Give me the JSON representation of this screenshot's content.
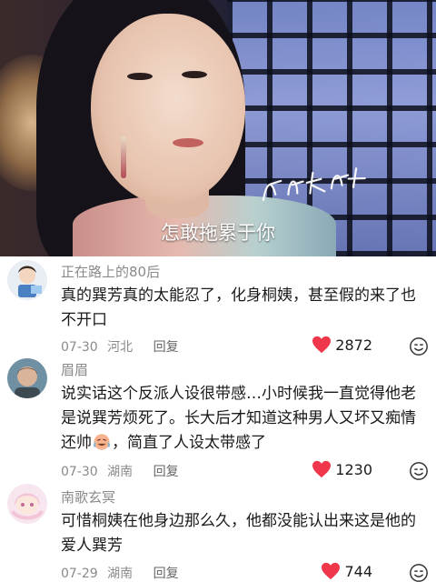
{
  "video": {
    "subtitle": "怎敢拖累于你"
  },
  "comments": [
    {
      "username": "正在路上的80后",
      "text": "真的巽芳真的太能忍了，化身桐姨，甚至假的来了也不开口",
      "date": "07-30",
      "location": "河北",
      "reply_label": "回复",
      "likes": "2872"
    },
    {
      "username": "眉眉",
      "text_before_emoji": "说实话这个反派人设很带感…小时候我一直觉得他老是说巽芳烦死了。长大后才知道这种男人又坏又痴情还帅",
      "emoji": "laughing-crying-emoji",
      "text_after_emoji": "，简直了人设太带感了",
      "date": "07-30",
      "location": "湖南",
      "reply_label": "回复",
      "likes": "1230"
    },
    {
      "username": "南歌玄冥",
      "text": "可惜桐姨在他身边那么久，他都没能认出来这是他的爱人巽芳",
      "date": "07-29",
      "location": "湖南",
      "reply_label": "回复",
      "likes": "744"
    }
  ],
  "colors": {
    "like_heart": "#f0364a",
    "username": "#8a8a8a",
    "body_text": "#1a1a1a"
  }
}
